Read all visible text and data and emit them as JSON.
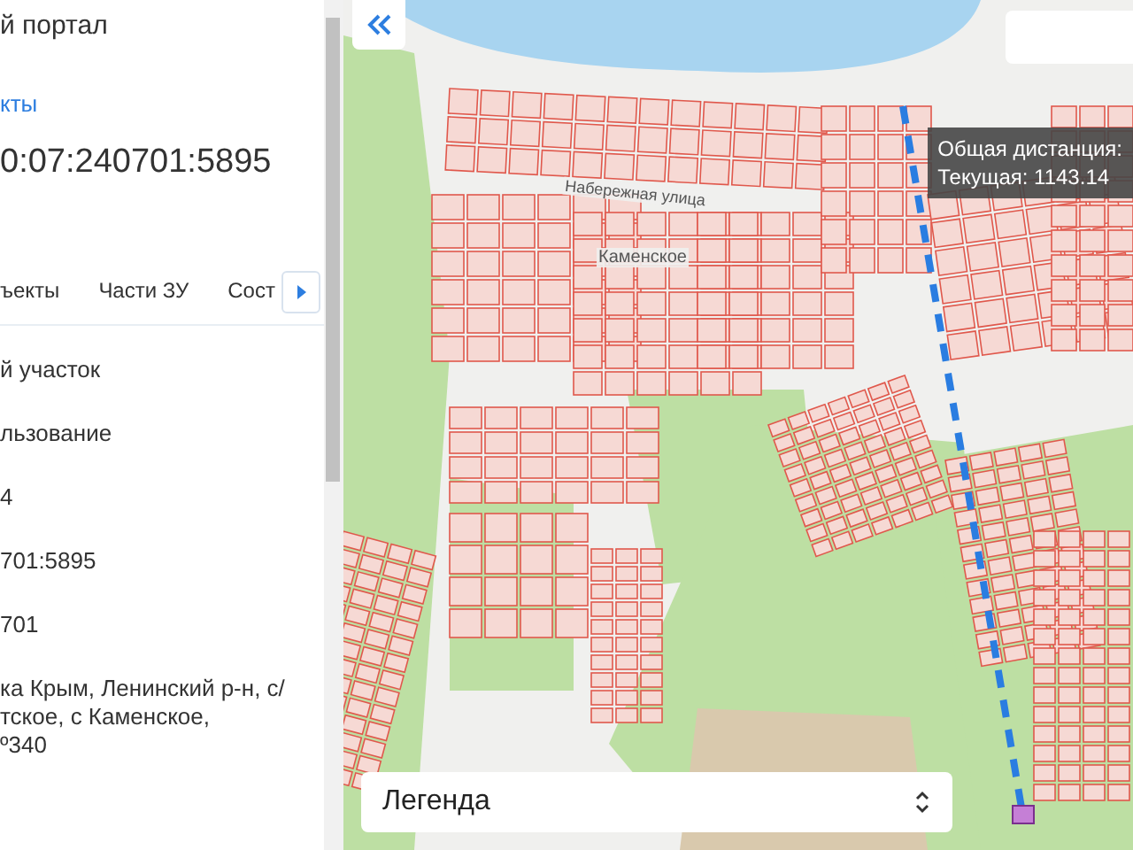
{
  "panel": {
    "title": "й портал",
    "link": "кты",
    "cadastral_number": "0:07:240701:5895",
    "tabs": [
      {
        "label": "ъекты"
      },
      {
        "label": "Части ЗУ"
      },
      {
        "label": "Сост"
      }
    ],
    "fields": [
      {
        "lines": [
          "й участок"
        ]
      },
      {
        "lines": [
          "льзование"
        ]
      },
      {
        "lines": [
          "4"
        ]
      },
      {
        "lines": [
          "701:5895"
        ]
      },
      {
        "lines": [
          "701"
        ]
      },
      {
        "lines": [
          "ка Крым, Ленинский р-н, с/",
          "тское, с Каменское,",
          "º340"
        ]
      }
    ]
  },
  "map": {
    "labels": [
      {
        "text": "Набережная улица",
        "kind": "street"
      },
      {
        "text": "Каменское",
        "kind": "place"
      }
    ],
    "tooltip": {
      "lines": [
        "Общая дистанция:",
        "Текущая: 1143.14"
      ]
    },
    "legend": {
      "label": "Легенда"
    }
  }
}
